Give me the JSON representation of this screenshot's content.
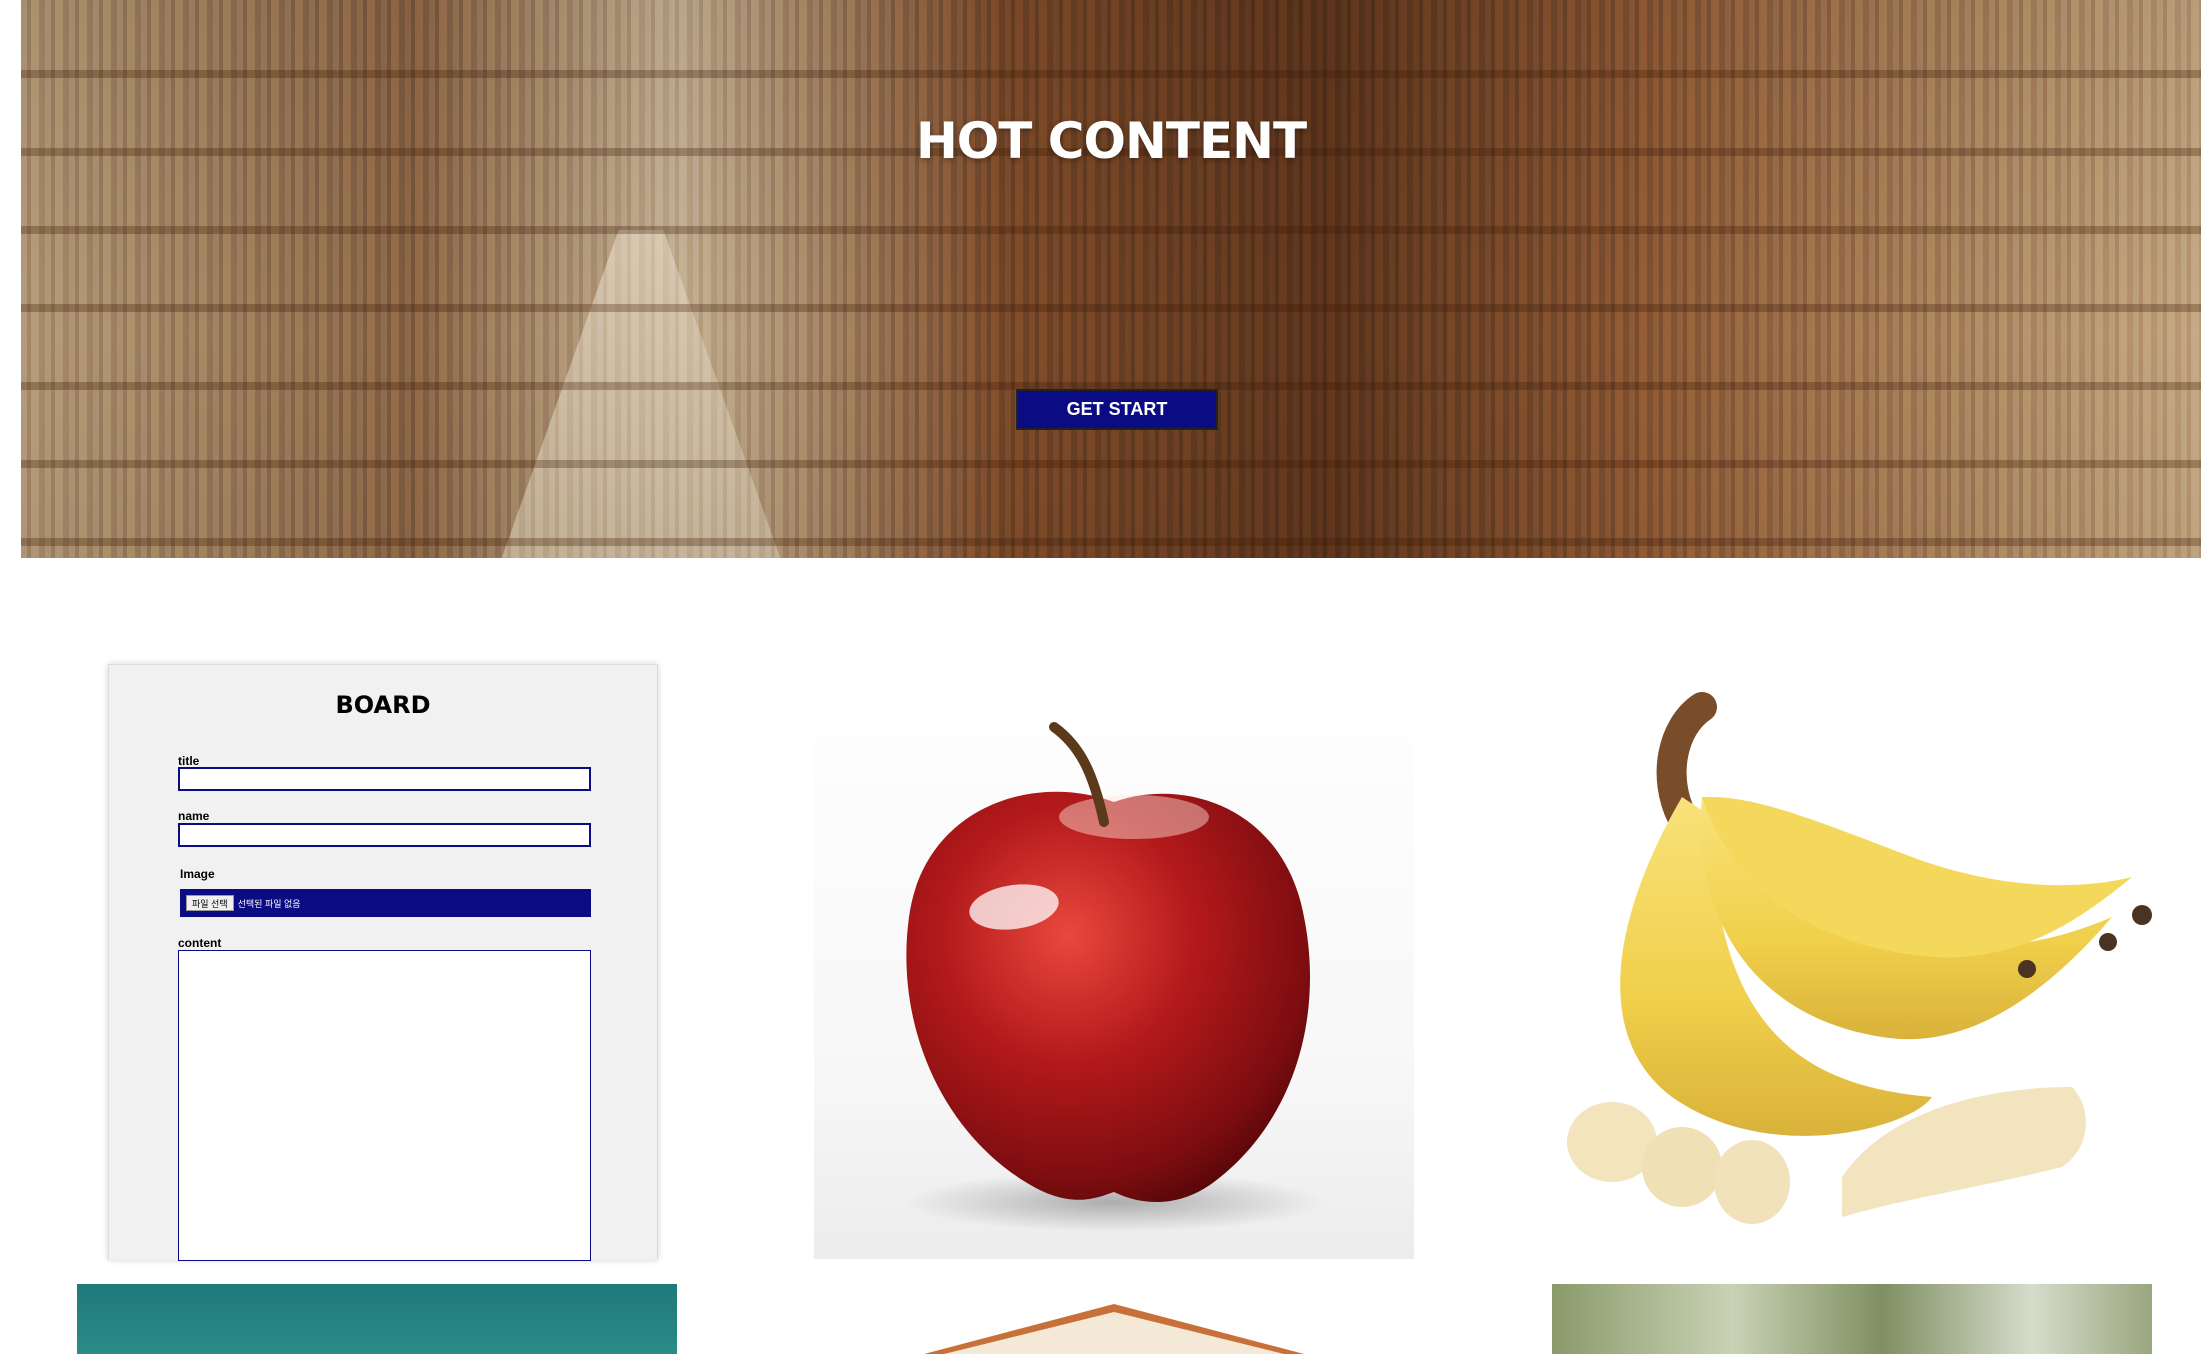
{
  "hero": {
    "title": "HOT CONTENT",
    "button_label": "GET START"
  },
  "board": {
    "title": "BOARD",
    "fields": {
      "title_label": "title",
      "name_label": "name",
      "image_label": "Image",
      "file_button_label": "파일 선택",
      "file_status": "선택된 파일 없음",
      "content_label": "content"
    }
  },
  "images": {
    "apple": "apple-photo",
    "banana": "banana-photo",
    "bottom_left": "teal-photo",
    "bottom_center": "book-photo",
    "bottom_right": "nature-photo"
  },
  "colors": {
    "accent": "#0b0b84",
    "card_bg": "#f1f1f1"
  }
}
